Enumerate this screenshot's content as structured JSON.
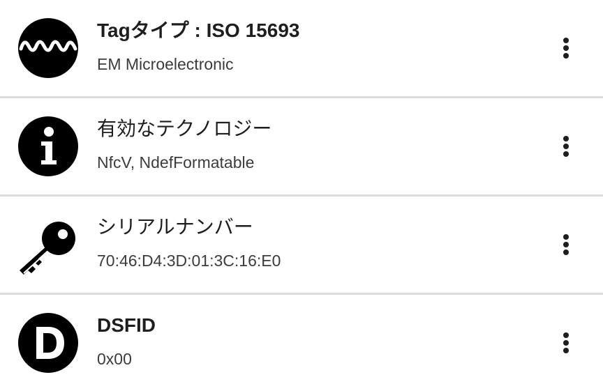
{
  "rows": [
    {
      "icon": "waveform-icon",
      "title": "Tagタイプ : ISO 15693",
      "subtitle": "EM Microelectronic"
    },
    {
      "icon": "info-icon",
      "title": "有効なテクノロジー",
      "subtitle": "NfcV, NdefFormatable"
    },
    {
      "icon": "key-icon",
      "title": "シリアルナンバー",
      "subtitle": "70:46:D4:3D:01:3C:16:E0"
    },
    {
      "icon": "letter-d-icon",
      "title": "DSFID",
      "subtitle": "0x00"
    }
  ],
  "menu_icon": "more-vert-icon",
  "colors": {
    "icon": "#000000",
    "text_primary": "#1e1e1e",
    "text_secondary": "#3c3c3c",
    "divider": "#dcdcdc"
  }
}
